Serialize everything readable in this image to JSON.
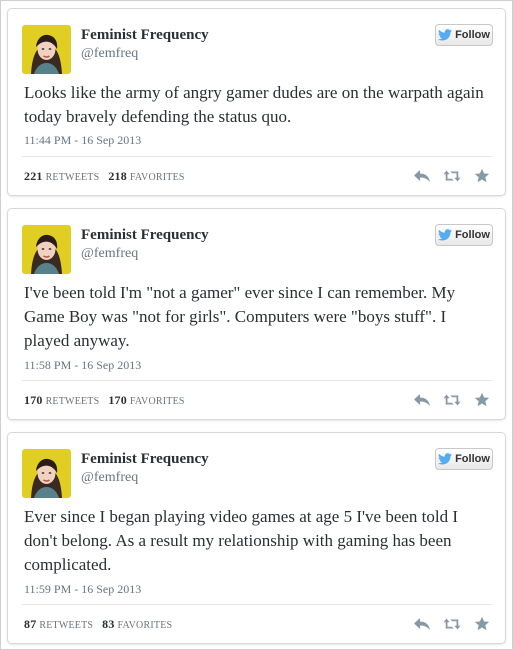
{
  "tweets": [
    {
      "name": "Feminist Frequency",
      "handle": "@femfreq",
      "follow_label": "Follow",
      "text": "Looks like the army of angry gamer dudes are on the warpath again today bravely defending the status quo.",
      "timestamp": "11:44 PM - 16 Sep 2013",
      "retweets": "221",
      "retweets_label": "RETWEETS",
      "favorites": "218",
      "favorites_label": "FAVORITES"
    },
    {
      "name": "Feminist Frequency",
      "handle": "@femfreq",
      "follow_label": "Follow",
      "text": "I've been told I'm \"not a gamer\" ever since I can remember. My Game Boy was \"not for girls\". Computers were \"boys stuff\". I played anyway.",
      "timestamp": "11:58 PM - 16 Sep 2013",
      "retweets": "170",
      "retweets_label": "RETWEETS",
      "favorites": "170",
      "favorites_label": "FAVORITES"
    },
    {
      "name": "Feminist Frequency",
      "handle": "@femfreq",
      "follow_label": "Follow",
      "text": "Ever since I began playing video games at age 5 I've been told I don't belong. As a result my relationship with gaming has been complicated.",
      "timestamp": "11:59 PM - 16 Sep 2013",
      "retweets": "87",
      "retweets_label": "RETWEETS",
      "favorites": "83",
      "favorites_label": "FAVORITES"
    }
  ],
  "icons": {
    "follow": "twitter-bird-icon",
    "reply": "reply-icon",
    "retweet": "retweet-icon",
    "favorite": "star-icon"
  },
  "colors": {
    "twitter_blue": "#55acee",
    "avatar_bg": "#e3d426",
    "action_gray": "#8899a6"
  }
}
